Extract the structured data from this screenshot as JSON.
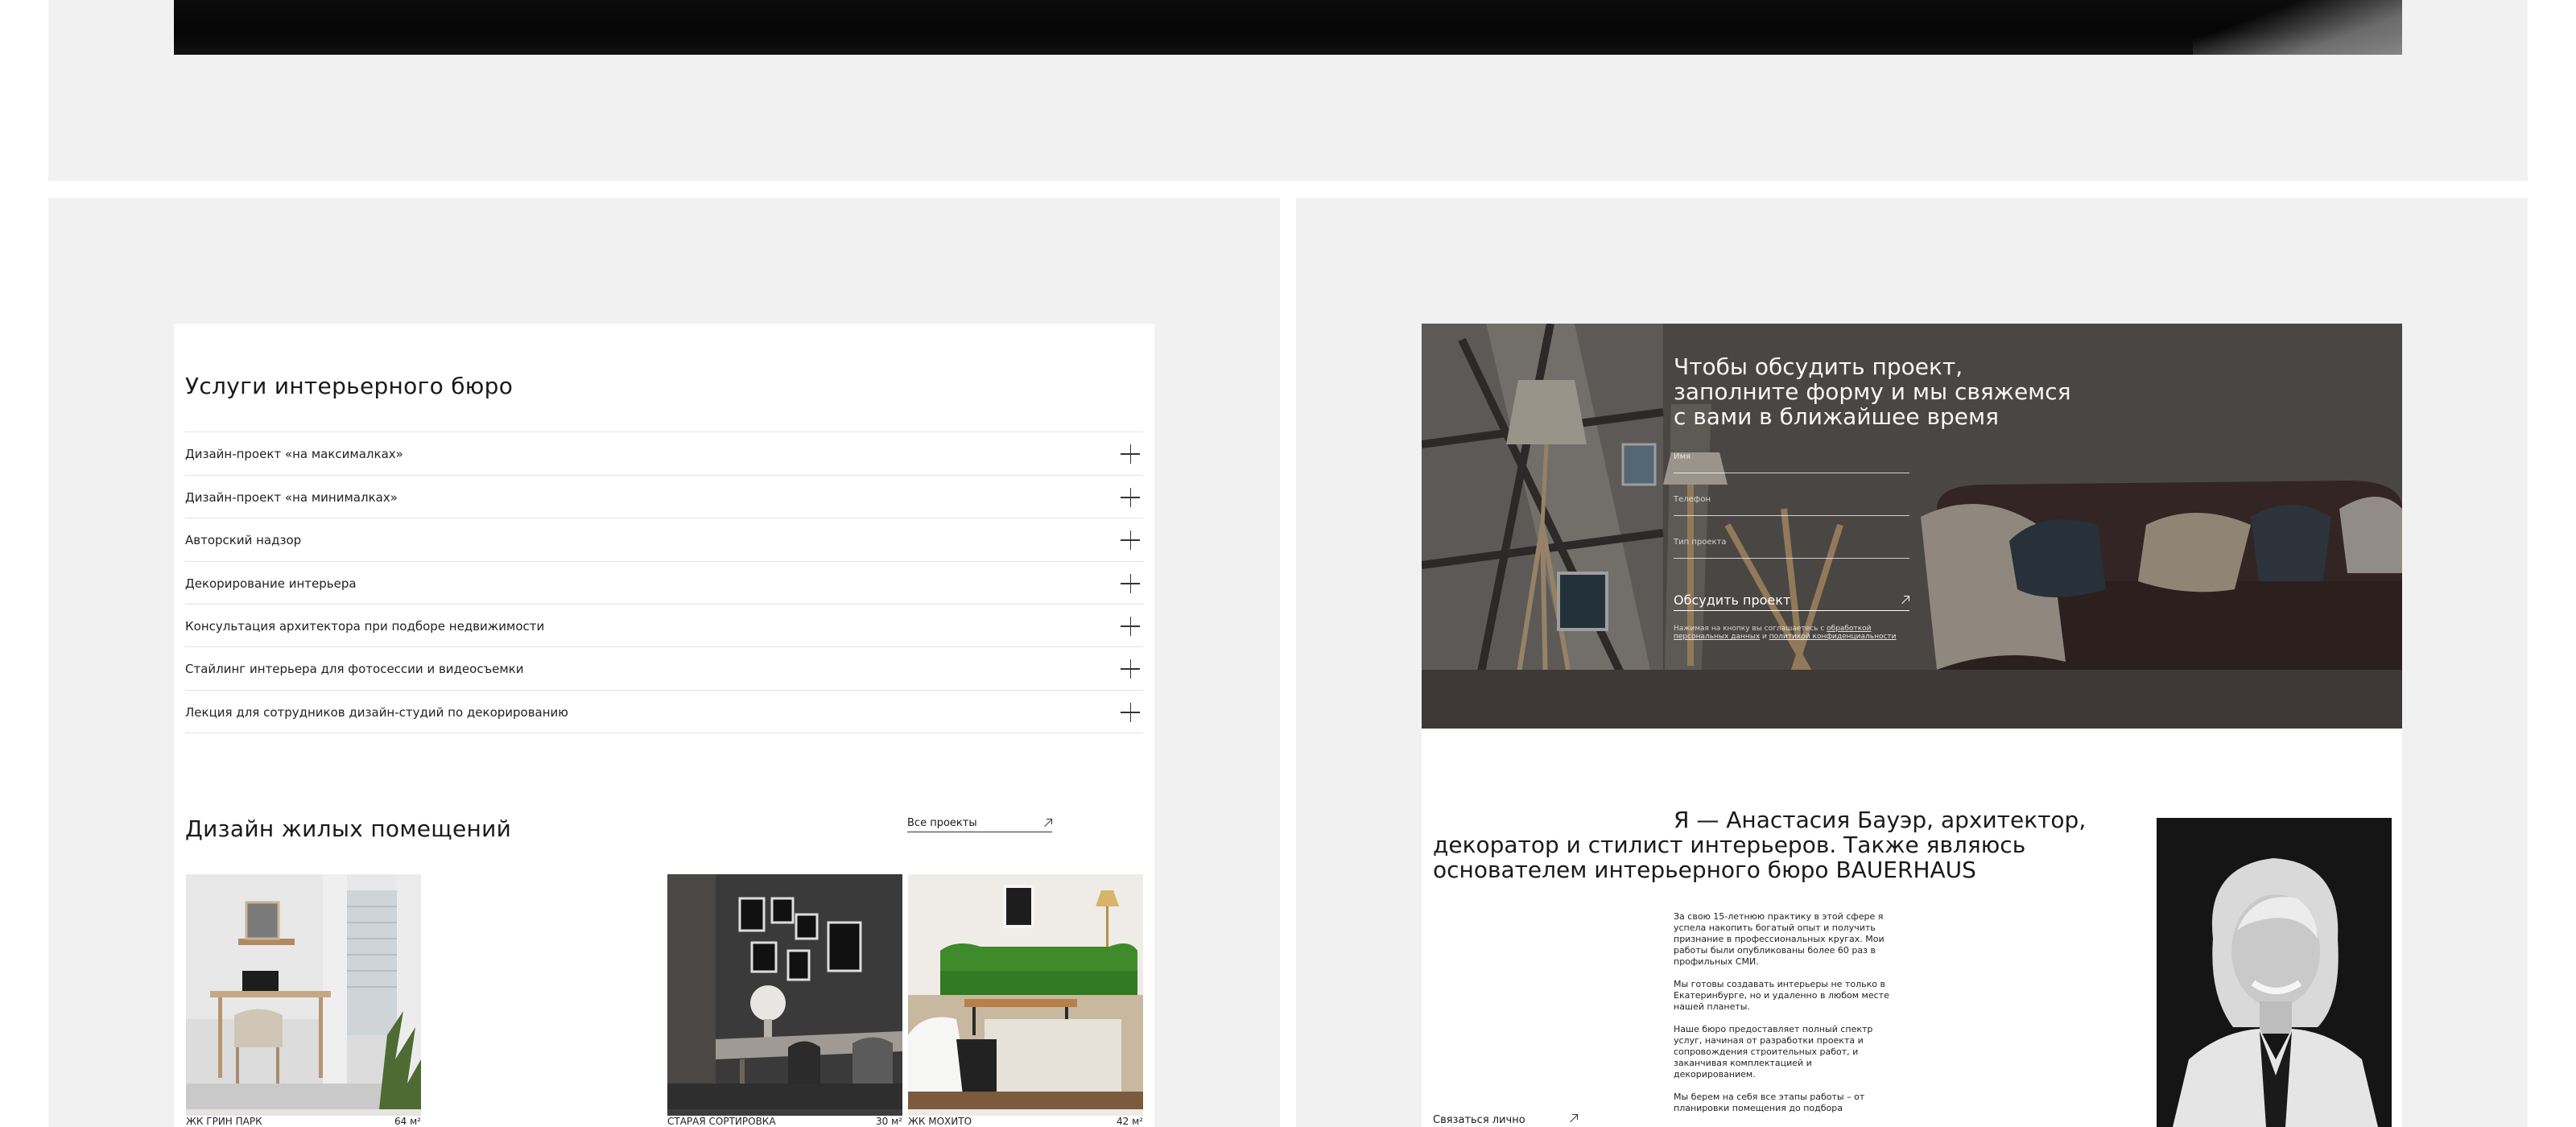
{
  "services": {
    "title": "Услуги интерьерного бюро",
    "items": [
      {
        "label": "Дизайн-проект «на максималках»"
      },
      {
        "label": "Дизайн-проект «на минималках»"
      },
      {
        "label": "Авторский надзор"
      },
      {
        "label": "Декорирование интерьера"
      },
      {
        "label": "Консультация архитектора при подборе недвижимости"
      },
      {
        "label": "Стайлинг интерьера для фотосессии и видеосъемки"
      },
      {
        "label": "Лекция для сотрудников дизайн-студий по декорированию"
      }
    ]
  },
  "residential": {
    "title": "Дизайн жилых помещений",
    "all_projects_label": "Все проекты",
    "projects": [
      {
        "name": "ЖК ГРИН ПАРК",
        "area": "64 м²"
      },
      {
        "name": "СТАРАЯ СОРТИРОВКА",
        "area": "30 м²"
      },
      {
        "name": "ЖК МОХИТО",
        "area": "42 м²"
      }
    ]
  },
  "form": {
    "title_line1": "Чтобы обсудить проект,",
    "title_line2": "заполните форму и мы свяжемся",
    "title_line3": "с вами в ближайшее время",
    "name_placeholder": "Имя",
    "phone_placeholder": "Телефон",
    "project_type_placeholder": "Тип проекта",
    "submit_label": "Обсудить проект",
    "consent_prefix": "Нажимая на кнопку вы соглашаетесь с",
    "consent_link1": "обработкой персональных данных",
    "consent_and": "и",
    "consent_link2": "политикой конфиденциальности"
  },
  "about": {
    "heading_line1": "Я — Анастасия Бауэр, архитектор,",
    "heading_line2": "декоратор и стилист интерьеров. Также являюсь",
    "heading_line3": "основателем интерьерного бюро BAUERHAUS",
    "para1": "За свою 15-летнюю практику в этой сфере я успела накопить богатый опыт и получить признание в профессиональных кругах. Мои работы были опубликованы более 60 раз в профильных СМИ.",
    "para2": "Мы готовы создавать интерьеры не только в Екатеринбурге, но и удаленно в любом месте нашей планеты.",
    "para3": "Наше бюро предоставляет полный спектр услуг, начиная от разработки проекта и сопровождения строительных работ, и заканчивая комплектацией и декорированием.",
    "para4": "Мы берем на себя все этапы работы – от планировки помещения до подбора",
    "contact_label": "Связаться лично"
  },
  "colors": {
    "panel_bg": "#f1f1f1",
    "card_bg": "#ffffff",
    "text": "#1a1a1a"
  }
}
